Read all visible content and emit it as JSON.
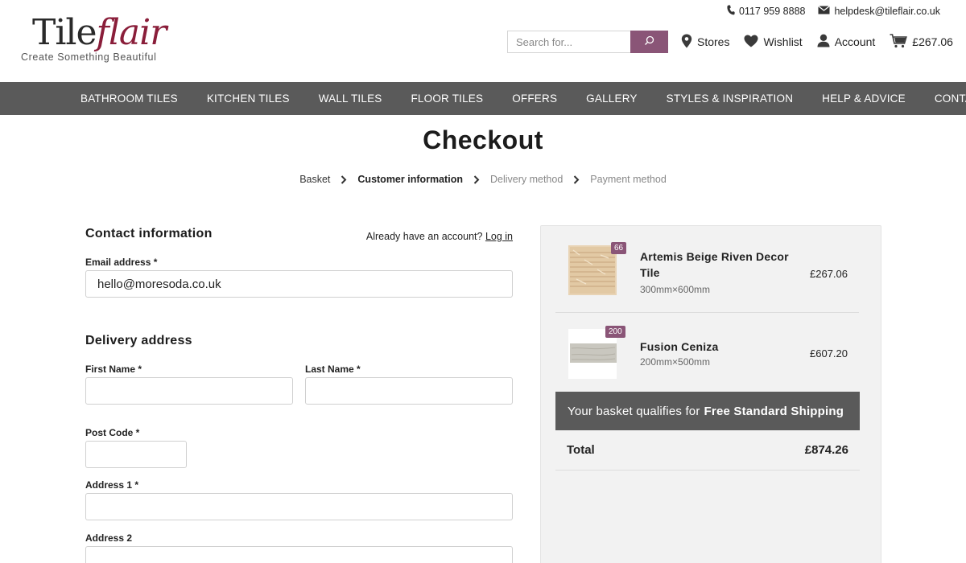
{
  "brand": {
    "logo_tile": "Tile",
    "logo_flair": "flair",
    "tagline": "Create Something Beautiful"
  },
  "contact": {
    "phone": "0117 959 8888",
    "email": "helpdesk@tileflair.co.uk"
  },
  "search": {
    "placeholder": "Search for..."
  },
  "utility": {
    "stores": "Stores",
    "wishlist": "Wishlist",
    "account": "Account",
    "basket_total": "£267.06"
  },
  "nav": [
    "BATHROOM TILES",
    "KITCHEN TILES",
    "WALL TILES",
    "FLOOR TILES",
    "OFFERS",
    "GALLERY",
    "STYLES & INSPIRATION",
    "HELP & ADVICE",
    "CONTACT"
  ],
  "page": {
    "title": "Checkout"
  },
  "breadcrumb": [
    "Basket",
    "Customer information",
    "Delivery method",
    "Payment method"
  ],
  "form": {
    "contact_title": "Contact information",
    "have_account": "Already have an account?",
    "login_link": "Log in",
    "email_label": "Email address *",
    "email_value": "hello@moresoda.co.uk",
    "delivery_title": "Delivery address",
    "first_name_label": "First Name *",
    "last_name_label": "Last Name *",
    "postcode_label": "Post Code *",
    "address1_label": "Address 1 *",
    "address2_label": "Address 2"
  },
  "summary": {
    "items": [
      {
        "name": "Artemis Beige Riven Decor Tile",
        "size": "300mm×600mm",
        "price": "£267.06",
        "qty": "66"
      },
      {
        "name": "Fusion Ceniza",
        "size": "200mm×500mm",
        "price": "£607.20",
        "qty": "200"
      }
    ],
    "shipping_prefix": "Your basket qualifies for",
    "shipping_bold": "Free Standard Shipping",
    "total_label": "Total",
    "total_value": "£874.26"
  },
  "colors": {
    "brand_accent": "#8a1e3a",
    "button_plum": "#8a5577",
    "nav_bg": "#5a5a5a"
  }
}
